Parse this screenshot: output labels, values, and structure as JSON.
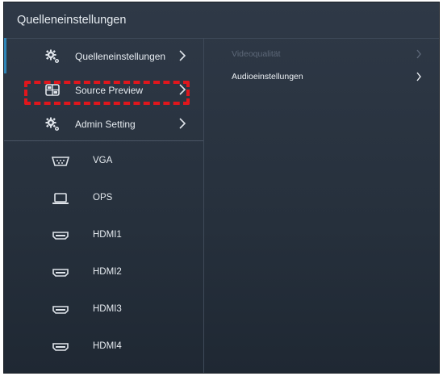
{
  "window": {
    "title": "Quelleneinstellungen"
  },
  "menu": [
    {
      "label": "Quelleneinstellungen",
      "icon": "gear-icon"
    },
    {
      "label": "Source Preview",
      "icon": "source-preview-icon"
    },
    {
      "label": "Admin Setting",
      "icon": "gear-icon"
    }
  ],
  "sources": [
    {
      "label": "VGA",
      "icon": "vga-port-icon"
    },
    {
      "label": "OPS",
      "icon": "laptop-icon"
    },
    {
      "label": "HDMI1",
      "icon": "hdmi-port-icon"
    },
    {
      "label": "HDMI2",
      "icon": "hdmi-port-icon"
    },
    {
      "label": "HDMI3",
      "icon": "hdmi-port-icon"
    },
    {
      "label": "HDMI4",
      "icon": "hdmi-port-icon"
    }
  ],
  "submenu": [
    {
      "label": "Videoqualität",
      "state": "disabled"
    },
    {
      "label": "Audioeinstellungen",
      "state": "enabled"
    }
  ],
  "colors": {
    "accent": "#2f86b8",
    "highlight": "#e0161c",
    "panel": "#2a3441"
  }
}
